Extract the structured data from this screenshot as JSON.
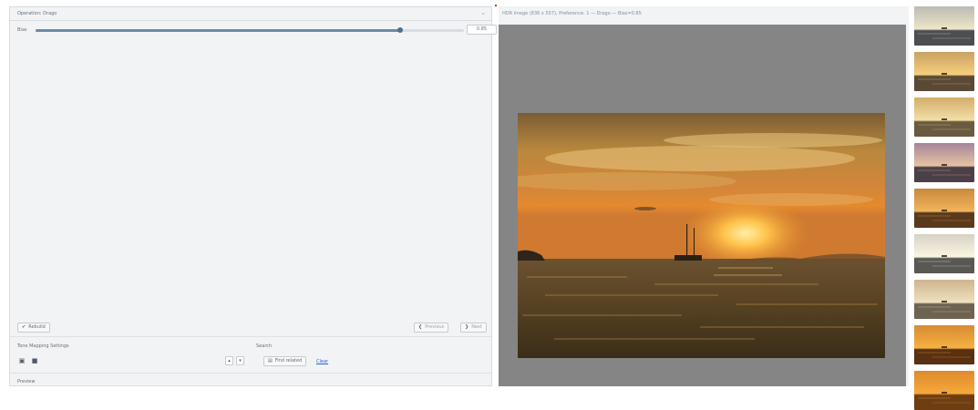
{
  "operation": {
    "title": "Operation: Drago",
    "expanded": true
  },
  "bias_slider": {
    "label": "Bias",
    "value": "0.85",
    "fraction": 0.85
  },
  "buttons": {
    "rebuild": "Rebuild",
    "previous": "Previous",
    "next": "Next",
    "find_related": "Find related",
    "clear": "Clear"
  },
  "sections": {
    "tonemapping": "Tone Mapping Settings",
    "search": "Search",
    "preview": "Preview"
  },
  "info": {
    "text": "HDR image (836 x 557), Preference: 1 — Drago — Bias=0.85"
  },
  "icons": {
    "chevron": "chevron-down-icon",
    "rebuild": "rebuild-icon",
    "prev": "arrow-left-icon",
    "next": "arrow-right-icon",
    "image": "image-icon",
    "folder": "folder-icon",
    "up": "arrow-up-icon",
    "down": "arrow-down-icon",
    "search": "image-search-icon"
  },
  "colors": {
    "panel_bg": "#f1f3f5",
    "canvas_bg": "#858585",
    "link": "#2d5fd0",
    "slider_fill": "#6d8aa6"
  },
  "thumbnails": [
    {
      "name": "thumb-1",
      "sky": "#bdbab0",
      "sun": "#ede6c9",
      "sea": "#4b4f52"
    },
    {
      "name": "thumb-2",
      "sky": "#c9a163",
      "sun": "#f6cf7d",
      "sea": "#5a4a35"
    },
    {
      "name": "thumb-3",
      "sky": "#d3ad6a",
      "sun": "#f3dfa8",
      "sea": "#6a5a40"
    },
    {
      "name": "thumb-4",
      "sky": "#a4859a",
      "sun": "#e8c3a1",
      "sea": "#4c4048"
    },
    {
      "name": "thumb-5",
      "sky": "#c88a3c",
      "sun": "#f2b45c",
      "sea": "#5a3a1c"
    },
    {
      "name": "thumb-6",
      "sky": "#d6d2c4",
      "sun": "#fbf5e2",
      "sea": "#5a5854"
    },
    {
      "name": "thumb-7",
      "sky": "#cdb58e",
      "sun": "#efe0bf",
      "sea": "#6e6350"
    },
    {
      "name": "thumb-8",
      "sky": "#d68b32",
      "sun": "#f7b142",
      "sea": "#593011"
    },
    {
      "name": "thumb-9",
      "sky": "#dd8a2e",
      "sun": "#f6a93b",
      "sea": "#6e3d12"
    }
  ]
}
